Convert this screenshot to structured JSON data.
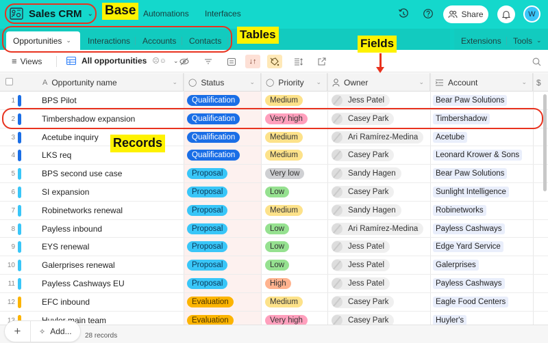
{
  "topbar": {
    "base_title": "Sales CRM",
    "nav": [
      "Automations",
      "Interfaces"
    ],
    "icons": [
      "history-icon",
      "help-icon"
    ],
    "share_label": "Share",
    "avatar_initial": "W"
  },
  "tables": {
    "tabs": [
      "Opportunities",
      "Interactions",
      "Accounts",
      "Contacts"
    ],
    "active": "Opportunities",
    "right": [
      "Extensions",
      "Tools"
    ]
  },
  "toolbar": {
    "views_label": "Views",
    "view_name": "All opportunities",
    "icons": [
      "hide-fields-icon",
      "filter-icon",
      "group-icon",
      "sort-icon",
      "color-icon",
      "row-height-icon",
      "share-view-icon",
      "search-icon"
    ]
  },
  "columns": [
    {
      "label": "Opportunity name",
      "icon": "A"
    },
    {
      "label": "Status",
      "icon": "⊙"
    },
    {
      "label": "Priority",
      "icon": "⊙"
    },
    {
      "label": "Owner",
      "icon": "person"
    },
    {
      "label": "Account",
      "icon": "link"
    },
    {
      "label": "$",
      "icon": ""
    }
  ],
  "rows": [
    {
      "n": "1",
      "name": "BPS Pilot",
      "status": "Qualification",
      "priority": "Medium",
      "owner": "Jess Patel",
      "account": "Bear Paw Solutions"
    },
    {
      "n": "2",
      "name": "Timbershadow expansion",
      "status": "Qualification",
      "priority": "Very high",
      "owner": "Casey Park",
      "account": "Timbershadow"
    },
    {
      "n": "3",
      "name": "Acetube inquiry",
      "status": "Qualification",
      "priority": "Medium",
      "owner": "Ari Ramírez-Medina",
      "account": "Acetube"
    },
    {
      "n": "4",
      "name": "LKS req",
      "status": "Qualification",
      "priority": "Medium",
      "owner": "Casey Park",
      "account": "Leonard Krower & Sons"
    },
    {
      "n": "5",
      "name": "BPS second use case",
      "status": "Proposal",
      "priority": "Very low",
      "owner": "Sandy Hagen",
      "account": "Bear Paw Solutions"
    },
    {
      "n": "6",
      "name": "SI expansion",
      "status": "Proposal",
      "priority": "Low",
      "owner": "Casey Park",
      "account": "Sunlight Intelligence"
    },
    {
      "n": "7",
      "name": "Robinetworks renewal",
      "status": "Proposal",
      "priority": "Medium",
      "owner": "Sandy Hagen",
      "account": "Robinetworks"
    },
    {
      "n": "8",
      "name": "Payless inbound",
      "status": "Proposal",
      "priority": "Low",
      "owner": "Ari Ramírez-Medina",
      "account": "Payless Cashways"
    },
    {
      "n": "9",
      "name": "EYS renewal",
      "status": "Proposal",
      "priority": "Low",
      "owner": "Jess Patel",
      "account": "Edge Yard Service"
    },
    {
      "n": "10",
      "name": "Galerprises renewal",
      "status": "Proposal",
      "priority": "Low",
      "owner": "Jess Patel",
      "account": "Galerprises"
    },
    {
      "n": "11",
      "name": "Payless Cashways EU",
      "status": "Proposal",
      "priority": "High",
      "owner": "Jess Patel",
      "account": "Payless Cashways"
    },
    {
      "n": "12",
      "name": "EFC inbound",
      "status": "Evaluation",
      "priority": "Medium",
      "owner": "Casey Park",
      "account": "Eagle Food Centers"
    },
    {
      "n": "13",
      "name": "Huyler main team",
      "status": "Evaluation",
      "priority": "Very high",
      "owner": "Casey Park",
      "account": "Huyler's"
    }
  ],
  "status_colors": {
    "Qualification": {
      "bg": "#1a6ee6",
      "fg": "#ffffff"
    },
    "Proposal": {
      "bg": "#39c6f8",
      "fg": "#0b3a5a"
    },
    "Evaluation": {
      "bg": "#fcb400",
      "fg": "#4a3200"
    }
  },
  "priority_colors": {
    "Medium": "#fde28a",
    "Very high": "#ffa0bd",
    "Very low": "#cfd0d3",
    "Low": "#96e190",
    "High": "#ffb38f"
  },
  "footer": {
    "add_label": "Add...",
    "records": "28 records"
  },
  "annotations": {
    "base": "Base",
    "tables": "Tables",
    "fields": "Fields",
    "records": "Records",
    "outline_color": "#e8321e",
    "label_color": "#fef200"
  }
}
